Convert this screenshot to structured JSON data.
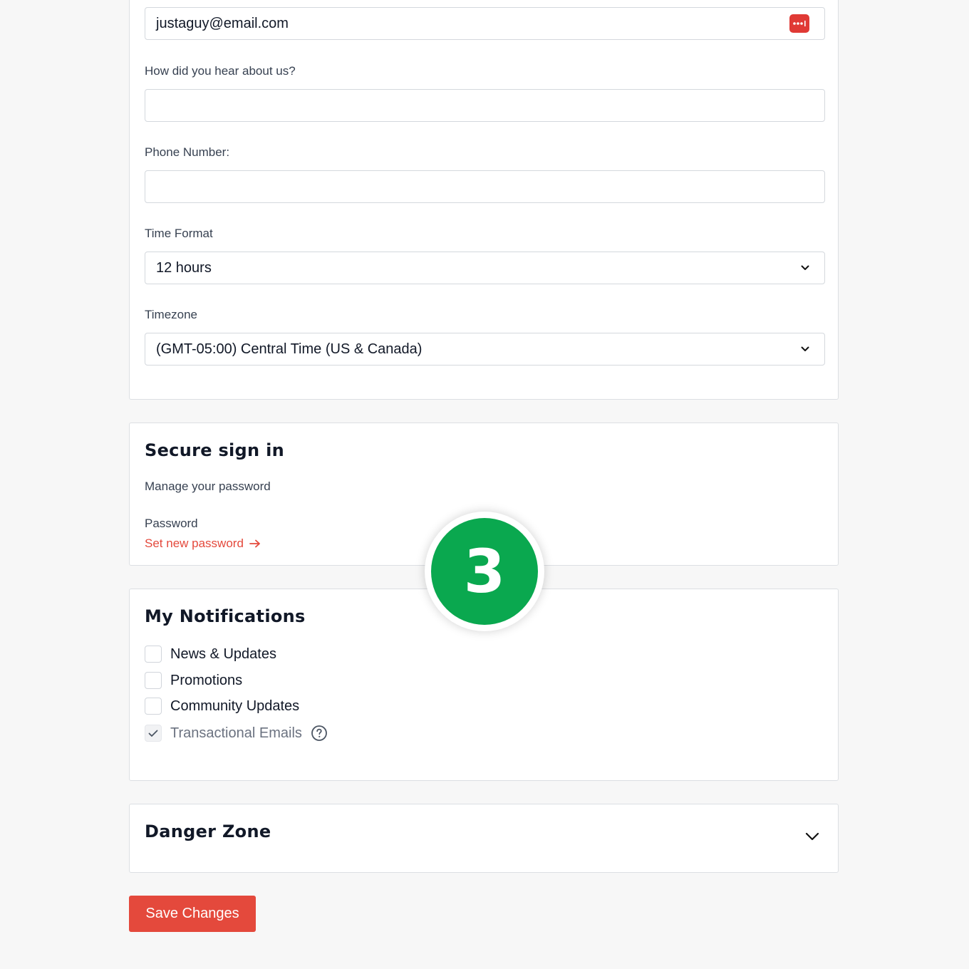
{
  "profile": {
    "email_value": "justaguy@email.com",
    "password_manager_icon": "password-manager-icon",
    "hear_label": "How did you hear about us?",
    "hear_value": "",
    "phone_label": "Phone Number:",
    "phone_value": "",
    "time_format_label": "Time Format",
    "time_format_value": "12 hours",
    "timezone_label": "Timezone",
    "timezone_value": "(GMT-05:00) Central Time (US & Canada)"
  },
  "secure": {
    "title": "Secure sign in",
    "subtitle": "Manage your password",
    "password_label": "Password",
    "set_password_link": "Set new password",
    "link_color": "#e4493c"
  },
  "notifications": {
    "title": "My Notifications",
    "items": [
      {
        "label": "News & Updates",
        "checked": false,
        "disabled": false
      },
      {
        "label": "Promotions",
        "checked": false,
        "disabled": false
      },
      {
        "label": "Community Updates",
        "checked": false,
        "disabled": false
      },
      {
        "label": "Transactional Emails",
        "checked": true,
        "disabled": true,
        "icon": "help-circle-icon"
      }
    ]
  },
  "danger": {
    "title": "Danger Zone",
    "icon": "chevron-down-icon"
  },
  "actions": {
    "save_label": "Save Changes",
    "save_color": "#e4493c"
  },
  "step_badge": {
    "number": "3",
    "color": "#0aa84f"
  }
}
